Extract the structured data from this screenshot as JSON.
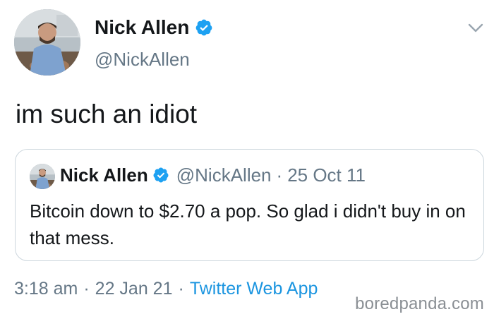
{
  "tweet": {
    "author": {
      "name": "Nick Allen",
      "handle": "@NickAllen",
      "verified": true
    },
    "text": "im such an idiot",
    "timestamp": "3:18 am",
    "date": "22 Jan 21",
    "source": "Twitter Web App",
    "separator": "·"
  },
  "quoted_tweet": {
    "author": {
      "name": "Nick Allen",
      "handle": "@NickAllen",
      "verified": true
    },
    "separator": "·",
    "date": "25 Oct 11",
    "text": "Bitcoin down to $2.70 a pop. So glad i didn't buy in on that mess."
  },
  "watermark": "boredpanda.com",
  "icons": {
    "avatar": "avatar-photo",
    "verified": "verified-badge-icon",
    "menu": "chevron-down-icon"
  },
  "colors": {
    "text": "#14171a",
    "secondary": "#657786",
    "link": "#1b95e0",
    "verified": "#1da1f2",
    "border": "#ccd6dd"
  }
}
